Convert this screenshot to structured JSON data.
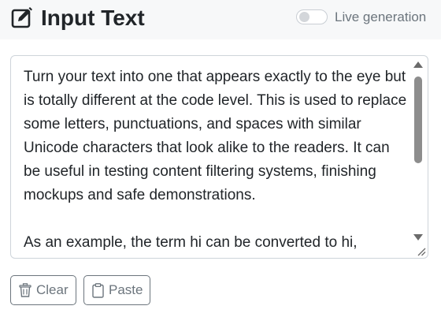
{
  "header": {
    "title": "Input Text",
    "title_icon": "pencil-square-icon",
    "live_toggle": {
      "label": "Live generation",
      "checked": false
    }
  },
  "input": {
    "value": "Turn your text into one that appears exactly to the eye but is totally different at the code level. This is used to replace some letters, punctuations, and spaces with similar Unicode characters that look alike to the readers. It can be useful in testing content filtering systems, finishing mockups and safe demonstrations.\n\nAs an example, the term hi can be converted to hi,"
  },
  "actions": {
    "clear": {
      "label": "Clear",
      "icon": "trash-icon"
    },
    "paste": {
      "label": "Paste",
      "icon": "clipboard-icon"
    }
  },
  "colors": {
    "text": "#212529",
    "muted": "#6c757d",
    "border": "#ced4da",
    "header_bg": "#f7f8f9"
  }
}
